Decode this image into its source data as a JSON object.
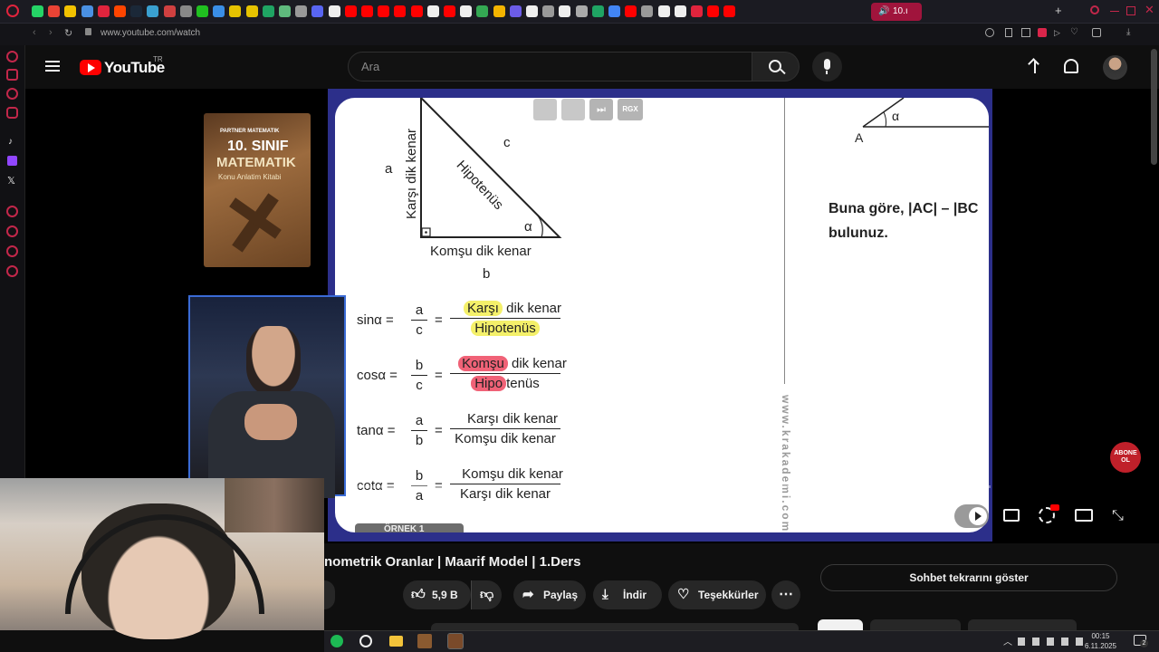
{
  "browser": {
    "url": "www.youtube.com/watch",
    "active_tab_label": "10.ı",
    "tab_icons": [
      "whatsapp-icon",
      "gmail-icon",
      "s-icon",
      "cloud-icon",
      "save-icon",
      "reddit-icon",
      "steam-icon",
      "l-icon",
      "circle-icon",
      "grid-icon",
      "power-icon",
      "check-icon",
      "s-icon",
      "s-icon",
      "sheet-icon",
      "leaf-icon",
      "link-icon",
      "discord-icon",
      "x-icon",
      "youtube-icon",
      "youtube-icon",
      "youtube-icon",
      "youtube-icon",
      "youtube-icon",
      "tiktok-icon",
      "youtube-icon",
      "tiktok-icon",
      "drive-icon",
      "triangle-icon",
      "notes-icon",
      "tiktok-icon",
      "puzzle-icon",
      "github-icon",
      "circle-icon",
      "sheet-icon",
      "chrome-icon",
      "youtube-icon",
      "puzzle-icon",
      "tiktok-icon",
      "tiktok-icon",
      "opera-icon",
      "youtube-icon",
      "youtube-icon"
    ]
  },
  "youtube": {
    "logo": "YouTube",
    "region": "TR",
    "search_placeholder": "Ara"
  },
  "video": {
    "title": "nometrik Oranlar | Maarif Model | 1.Ders",
    "book": {
      "series": "PARTNER MATEMATIK",
      "grade": "10. SINIF",
      "subject": "MATEMATIK",
      "subtitle": "Konu Anlatim Kitabi"
    },
    "whiteboard": {
      "label_a": "a",
      "label_b": "b",
      "label_c": "c",
      "label_opposite": "Karşı dik kenar",
      "label_hypotenuse": "Hipotenüs",
      "label_adjacent": "Komşu dik kenar",
      "alpha": "α",
      "point_a": "A",
      "question_line1": "Buna göre, |AC| – |BC",
      "question_line2": "bulunuz.",
      "watermark": "www.krakademi.com",
      "example_label": "ÖRNEK 1",
      "rgx": "RGX",
      "formulas": [
        {
          "fn": "sinα =",
          "num1": "a",
          "den1": "c",
          "num2": "Karşı dik kenar",
          "den2": "Hipotenüs"
        },
        {
          "fn": "cosα =",
          "num1": "b",
          "den1": "c",
          "num2": "Komşu dik kenar",
          "den2": "Hipotenüs"
        },
        {
          "fn": "tanα =",
          "num1": "a",
          "den1": "b",
          "num2": "Karşı dik kenar",
          "den2": "Komşu dik kenar"
        },
        {
          "fn": "cotα =",
          "num1": "b",
          "den1": "a",
          "num2": "Komşu dik kenar",
          "den2": "Karşı dik kenar"
        }
      ]
    },
    "subscribe_badge": "ABONE OL"
  },
  "actions": {
    "likes": "5,9 B",
    "share": "Paylaş",
    "download": "İndir",
    "thanks": "Teşekkürler",
    "chat_replay": "Sohbet tekrarını göster"
  },
  "taskbar": {
    "time": "00:15",
    "date": "6.11.2025",
    "notification_count": "2"
  },
  "colors": {
    "yt_red": "#ff0000",
    "highlight_yellow": "#f4f06a",
    "highlight_red": "#f06277",
    "video_frame": "#2c2f8a"
  }
}
